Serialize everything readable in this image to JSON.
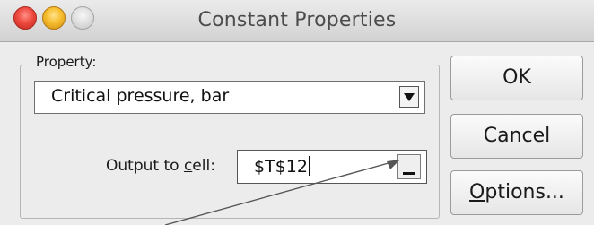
{
  "window": {
    "title": "Constant Properties"
  },
  "property_group": {
    "label": "Property:",
    "selected": "Critical pressure, bar"
  },
  "output": {
    "label_prefix": "Output to ",
    "label_mnemonic": "c",
    "label_suffix": "ell:",
    "value": "$T$12"
  },
  "buttons": {
    "ok": "OK",
    "cancel": "Cancel",
    "options_mnemonic": "O",
    "options_rest": "ptions..."
  },
  "colors": {
    "close": "#ee4a3f",
    "minimize": "#f6bd2e",
    "zoom": "#dcdcdc",
    "window_bg": "#ececec"
  },
  "icons": {
    "window_controls": [
      "close-light",
      "minimize-light",
      "zoom-light"
    ],
    "dropdown": "chevron-down-icon",
    "range_selector": "collapse-dialog-icon",
    "annotation": "arrow-pointer"
  }
}
